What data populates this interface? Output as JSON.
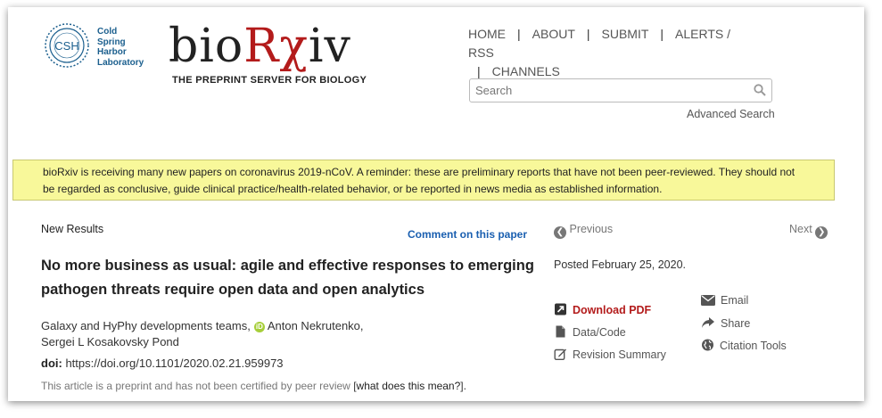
{
  "header": {
    "csh_abbrev": "CSH",
    "csh_lines": [
      "Cold",
      "Spring",
      "Harbor",
      "Laboratory"
    ],
    "logo_bio": "bio",
    "logo_rx": "Rχ",
    "logo_iv": "iv",
    "tagline": "THE PREPRINT SERVER FOR BIOLOGY"
  },
  "nav": {
    "home": "HOME",
    "about": "ABOUT",
    "submit": "SUBMIT",
    "alerts": "ALERTS / RSS",
    "channels": "CHANNELS",
    "separator": "|"
  },
  "search": {
    "placeholder": "Search",
    "advanced": "Advanced Search"
  },
  "banner": {
    "text": "bioRxiv is receiving many new papers on coronavirus 2019-nCoV.   A reminder: these are preliminary reports that have not been peer-reviewed. They should not be regarded as conclusive, guide clinical practice/health-related behavior, or be reported in news media as established information."
  },
  "article": {
    "section": "New Results",
    "comment": "Comment on this paper",
    "title": "No more business as usual: agile and effective responses to emerging pathogen threats require open data and open analytics",
    "author_group": "Galaxy and HyPhy developments teams,",
    "author_orcid": "Anton Nekrutenko,",
    "author_last": "Sergei L Kosakovsky Pond",
    "doi_label": "doi:",
    "doi_value": "https://doi.org/10.1101/2020.02.21.959973",
    "notice": "This article is a preprint and has not been certified by peer review",
    "notice_bracket_open": "[",
    "notice_link": "what does this mean?",
    "notice_bracket_close": "]."
  },
  "sidebar": {
    "previous": "Previous",
    "next": "Next",
    "posted": "Posted February 25, 2020.",
    "download_pdf": "Download PDF",
    "data_code": "Data/Code",
    "revision_summary": "Revision Summary",
    "email": "Email",
    "share": "Share",
    "citation_tools": "Citation Tools"
  },
  "colors": {
    "brand_red": "#b31b1b",
    "csh_blue": "#1b5f8e",
    "banner_yellow": "#f8f89a",
    "link_blue": "#1a5fb0"
  }
}
